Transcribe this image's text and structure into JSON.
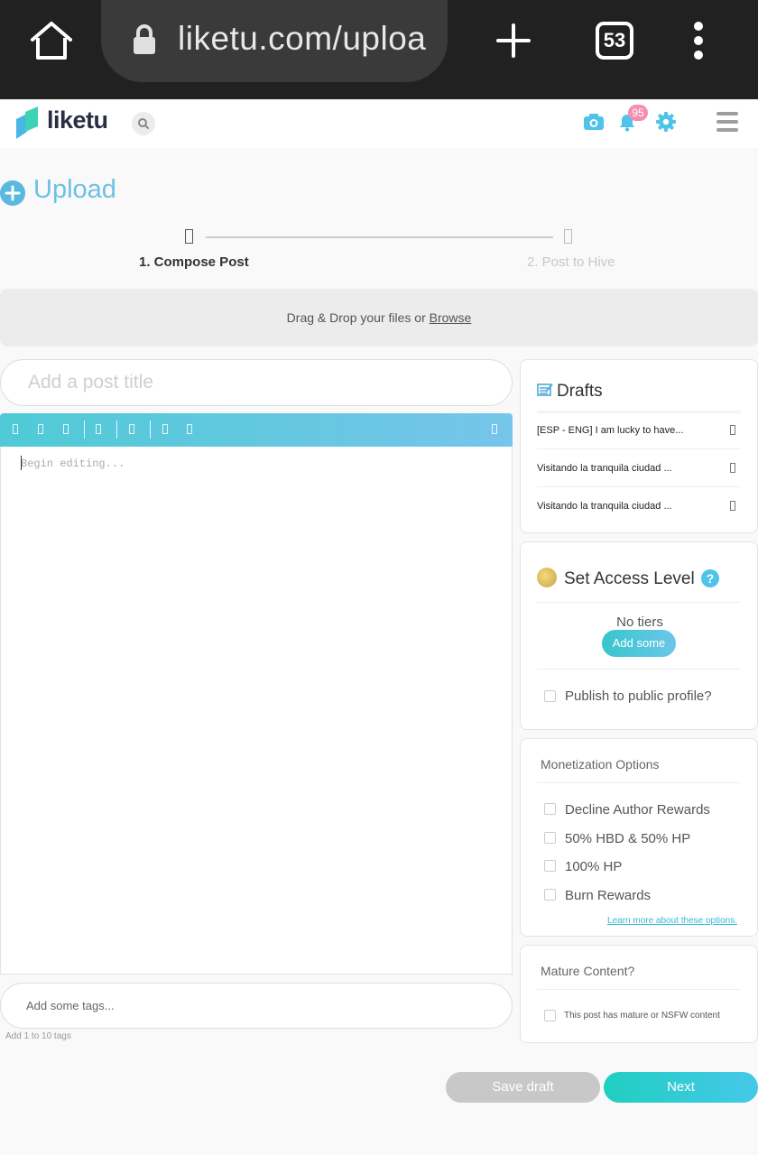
{
  "browser": {
    "url": "liketu.com/uploa",
    "tab_count": "53",
    "icons": [
      "home-icon",
      "lock-icon",
      "new-tab-icon",
      "tabs-icon",
      "kebab-menu-icon"
    ]
  },
  "header": {
    "brand": "liketu",
    "notification_count": "95",
    "accent_color": "#4fc3e8",
    "icons": [
      "search-icon",
      "camera-icon",
      "bell-icon",
      "gear-icon",
      "hamburger-menu-icon"
    ]
  },
  "page": {
    "title": "Upload"
  },
  "stepper": {
    "steps": [
      {
        "label": "1. Compose Post",
        "active": true
      },
      {
        "label": "2. Post to Hive",
        "active": false
      }
    ]
  },
  "dropzone": {
    "text": "Drag & Drop your files or ",
    "browse": "Browse"
  },
  "composer": {
    "title_placeholder": "Add a post title",
    "editor_placeholder": "Begin editing...",
    "tags_placeholder": "Add some tags...",
    "tags_hint": "Add 1 to 10 tags"
  },
  "drafts": {
    "title": "Drafts",
    "items": [
      {
        "label": "[ESP - ENG] I am lucky to have..."
      },
      {
        "label": "Visitando la tranquila ciudad ..."
      },
      {
        "label": "Visitando la tranquila ciudad ..."
      }
    ]
  },
  "access": {
    "title": "Set Access Level",
    "help": "?",
    "no_tiers": "No tiers",
    "add_some": "Add some",
    "publish_public": "Publish to public profile?"
  },
  "monetization": {
    "title": "Monetization Options",
    "options": [
      {
        "label": "Decline Author Rewards",
        "checked": false
      },
      {
        "label": "50% HBD & 50% HP",
        "checked": false
      },
      {
        "label": "100% HP",
        "checked": false
      },
      {
        "label": "Burn Rewards",
        "checked": false
      }
    ],
    "learn_more": "Learn more about these options."
  },
  "mature": {
    "title": "Mature Content?",
    "checkbox_label": "This post has mature or NSFW content"
  },
  "actions": {
    "save_draft": "Save draft",
    "next": "Next"
  }
}
